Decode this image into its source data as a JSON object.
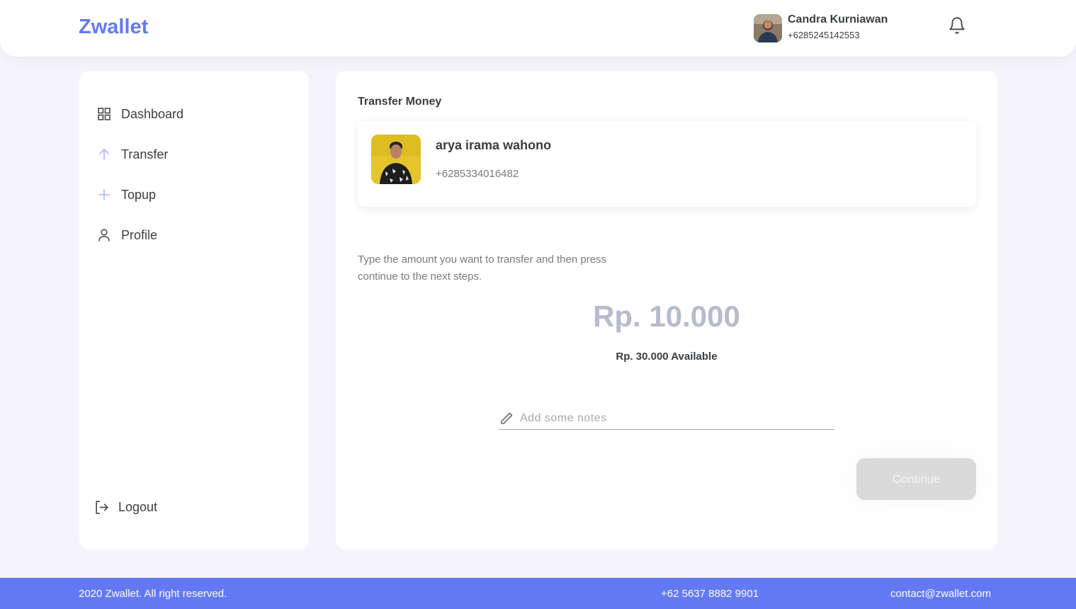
{
  "header": {
    "logo": "Zwallet",
    "user_name": "Candra Kurniawan",
    "user_phone": "+6285245142553",
    "notification_icon": "bell-icon"
  },
  "sidebar": {
    "items": [
      {
        "label": "Dashboard",
        "icon": "grid-icon"
      },
      {
        "label": "Transfer",
        "icon": "arrow-up-icon"
      },
      {
        "label": "Topup",
        "icon": "plus-icon"
      },
      {
        "label": "Profile",
        "icon": "user-icon"
      }
    ],
    "logout": {
      "label": "Logout",
      "icon": "logout-icon"
    }
  },
  "main": {
    "title": "Transfer Money",
    "receiver": {
      "name": "arya irama wahono",
      "phone": "+6285334016482"
    },
    "instruction": "Type the amount you want to transfer and then press continue to the next steps.",
    "amount": "Rp. 10.000",
    "available": "Rp. 30.000 Available",
    "notes_placeholder": "Add some notes",
    "notes_value": "",
    "continue_label": "Continue"
  },
  "footer": {
    "copyright": "2020 Zwallet. All right reserved.",
    "phone": "+62 5637 8882 9901",
    "email": "contact@zwallet.com"
  },
  "colors": {
    "brand": "#6379f4",
    "active_icon": "#b3b9f7",
    "background": "#f5f4fc",
    "button_disabled": "#dadada"
  }
}
